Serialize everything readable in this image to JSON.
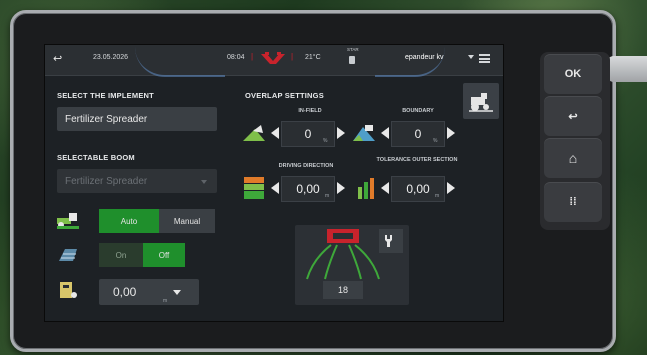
{
  "header": {
    "date": "23.05.2026",
    "time": "08:04",
    "temperature": "21°C",
    "status_small": "STAR",
    "profile": "epandeur kv"
  },
  "left": {
    "select_implement_title": "SELECT THE IMPLEMENT",
    "implement_value": "Fertilizer Spreader",
    "selectable_boom_title": "SELECTABLE BOOM",
    "boom_value": "Fertilizer Spreader",
    "mode": {
      "auto": "Auto",
      "manual": "Manual",
      "selected": "Auto"
    },
    "toggle": {
      "on": "On",
      "off": "Off",
      "selected": "Off"
    },
    "value_field": "0,00",
    "value_unit": "m"
  },
  "overlap": {
    "title": "OVERLAP SETTINGS",
    "in_field_label": "IN-FIELD",
    "in_field_value": "0",
    "in_field_unit": "%",
    "boundary_label": "BOUNDARY",
    "boundary_value": "0",
    "boundary_unit": "%",
    "driving_direction_label": "DRIVING DIRECTION",
    "driving_direction_value": "0,00",
    "driving_direction_unit": "m",
    "tolerance_label": "TOLERANCE OUTER SECTION",
    "tolerance_value": "0,00",
    "tolerance_unit": "m",
    "section_count": "18"
  },
  "hardware": {
    "ok": "OK",
    "back": "↩",
    "home": "⌂",
    "menu": "⁞⁞"
  },
  "colors": {
    "accent_green": "#1f8f2c",
    "screen_bg": "#1d2125",
    "field_bg": "#3a3f44"
  }
}
